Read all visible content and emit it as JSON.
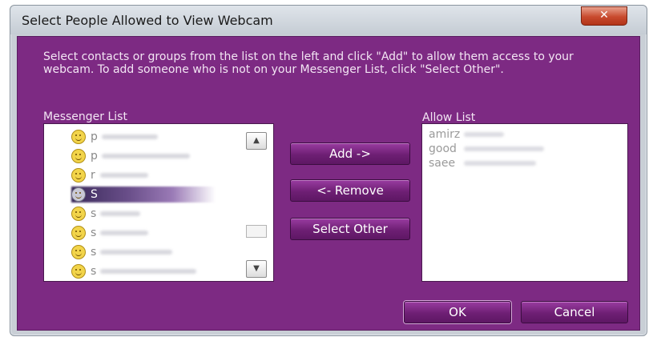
{
  "window": {
    "title": "Select People Allowed to View Webcam",
    "close_glyph": "✕"
  },
  "instructions": "Select contacts or groups from the list on the left and click \"Add\" to allow them access to your webcam. To add someone who is not on your Messenger List, click \"Select Other\".",
  "messenger_list": {
    "label": "Messenger List",
    "items": [
      {
        "text": "p",
        "icon": "smiley-icon",
        "selected": false
      },
      {
        "text": "p",
        "icon": "smiley-icon",
        "selected": false
      },
      {
        "text": "r",
        "icon": "smiley-icon",
        "selected": false
      },
      {
        "text": "S",
        "icon": "smiley-icon",
        "selected": true
      },
      {
        "text": "s",
        "icon": "smiley-icon",
        "selected": false
      },
      {
        "text": "s",
        "icon": "smiley-icon",
        "selected": false
      },
      {
        "text": "s",
        "icon": "smiley-icon",
        "selected": false
      },
      {
        "text": "s",
        "icon": "smiley-icon",
        "selected": false
      }
    ],
    "scroll_up_glyph": "▲",
    "scroll_down_glyph": "▼"
  },
  "buttons": {
    "add": "Add ->",
    "remove": "<- Remove",
    "select_other": "Select Other",
    "ok": "OK",
    "cancel": "Cancel"
  },
  "allow_list": {
    "label": "Allow List",
    "items": [
      "amirz",
      "good",
      "saee"
    ]
  },
  "colors": {
    "dialog_body": "#7d2a83",
    "button": "#6e1f74",
    "listbox": "#ffffff"
  }
}
